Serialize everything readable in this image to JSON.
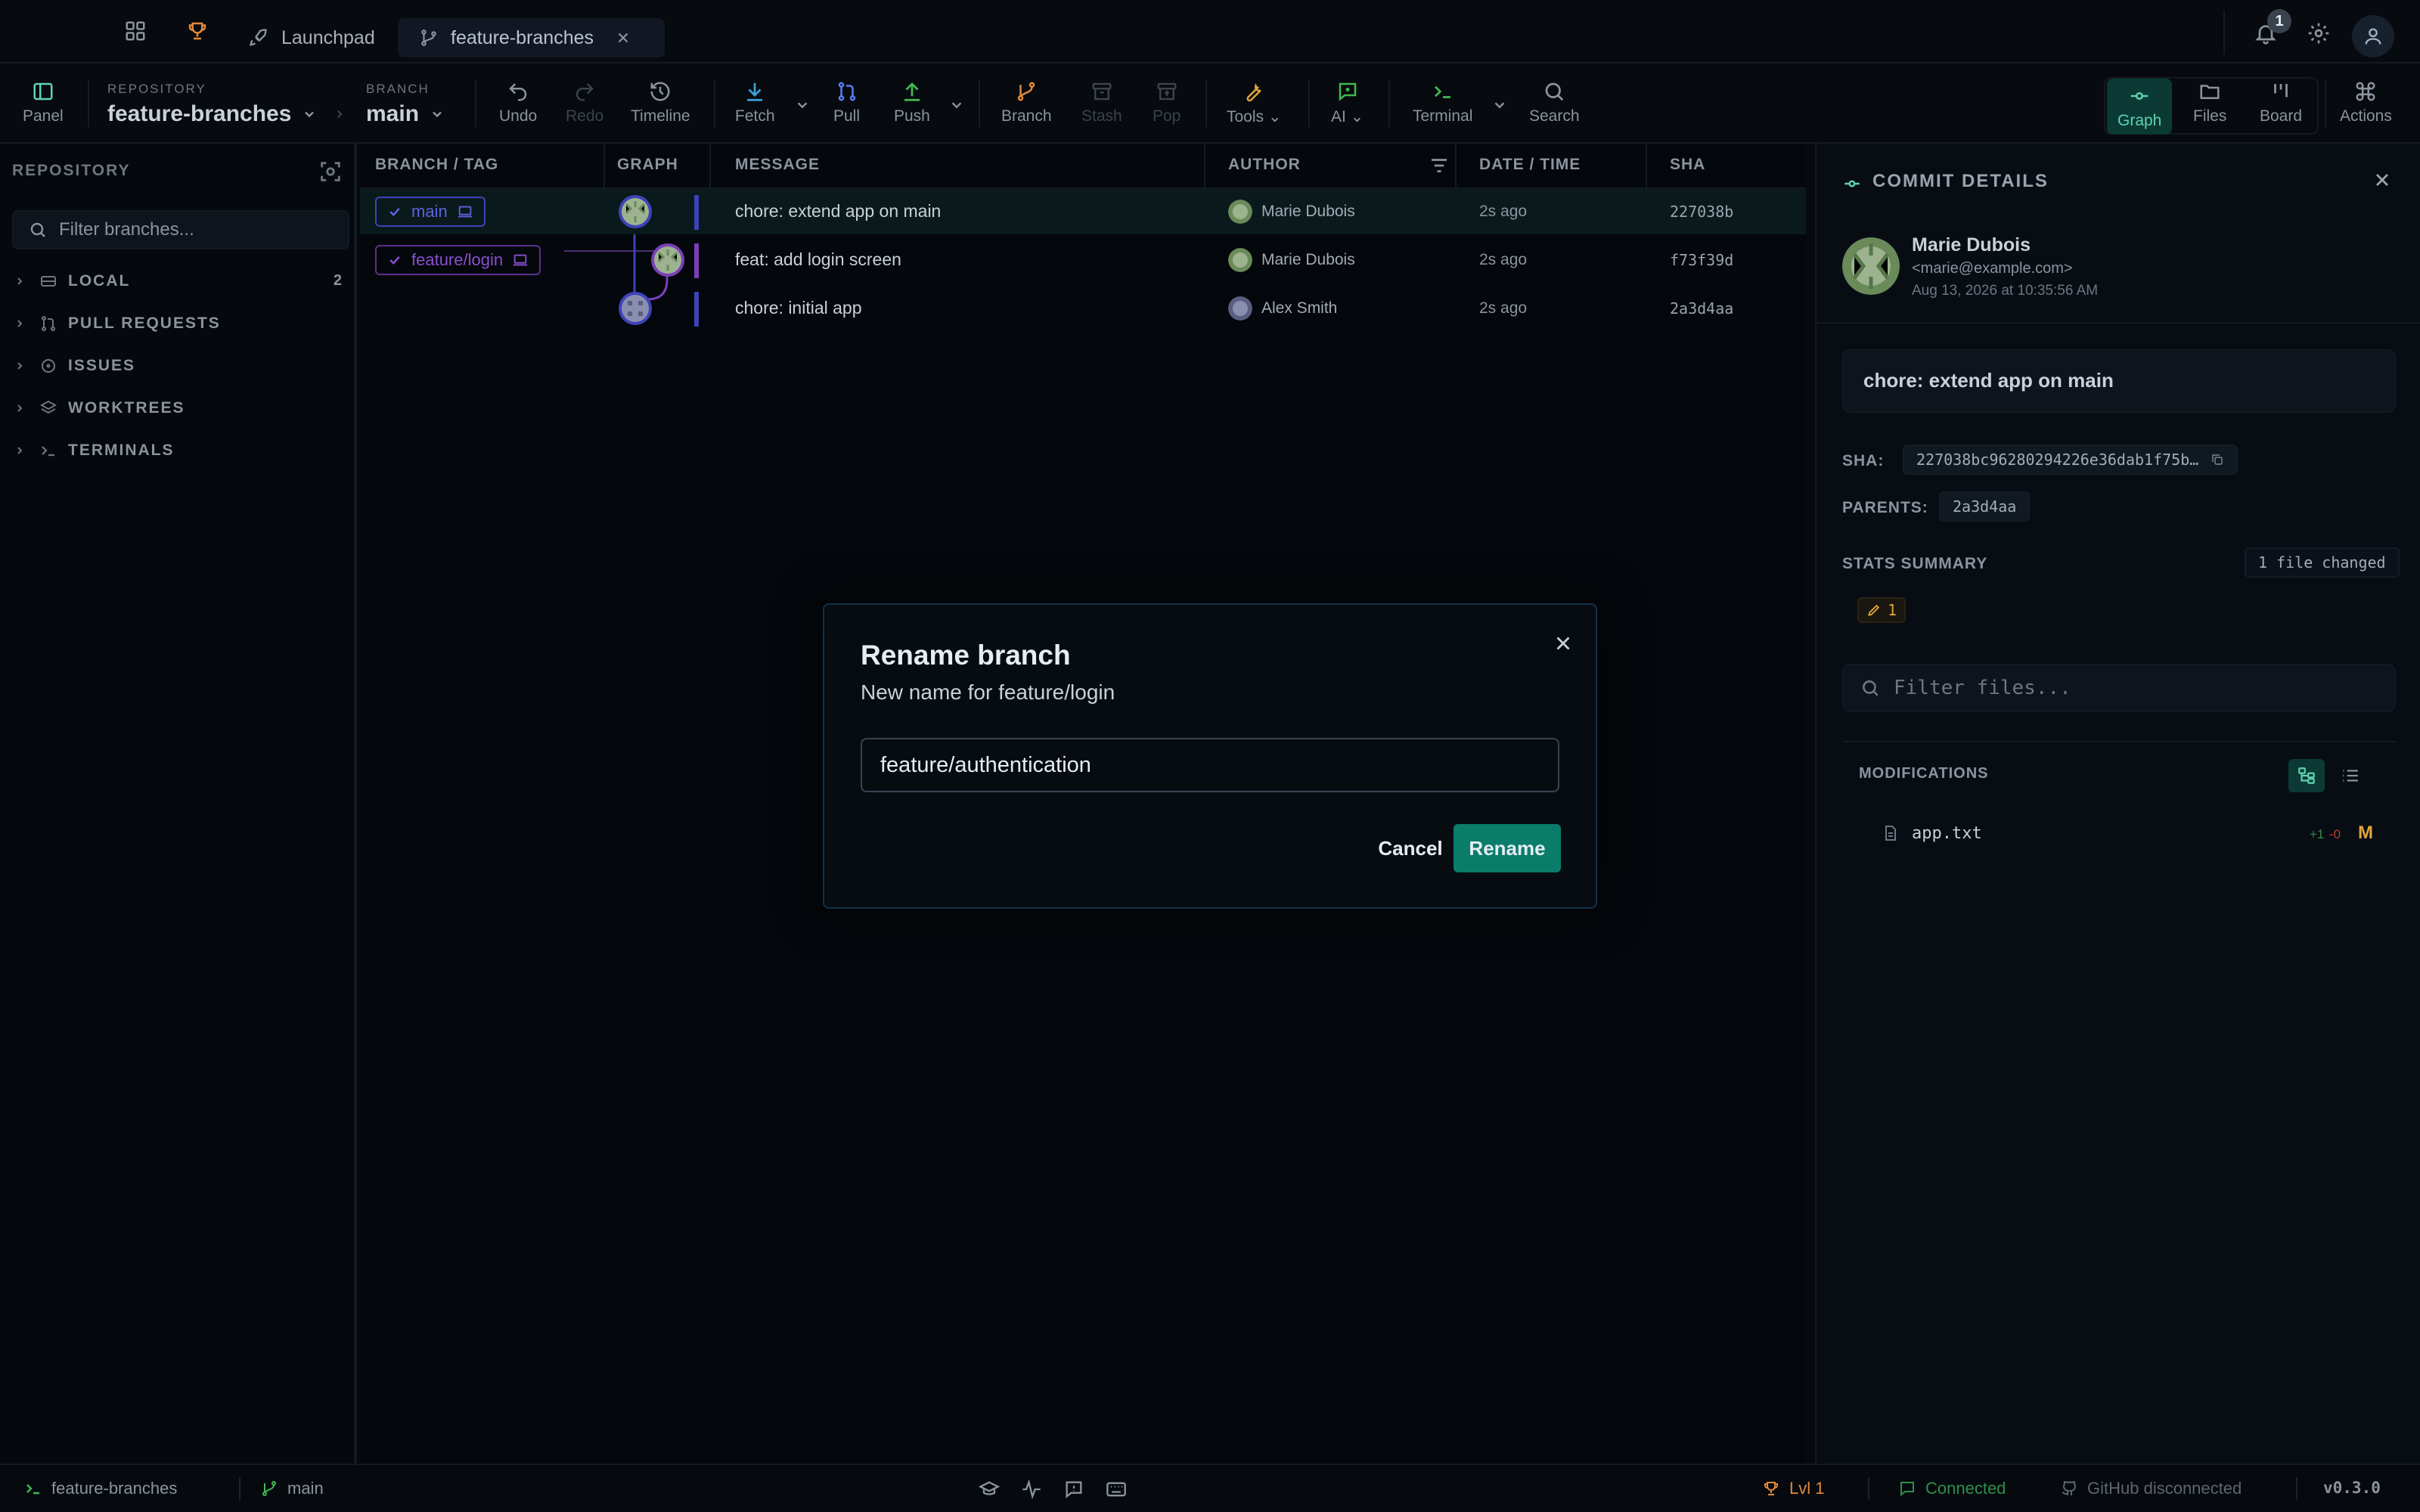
{
  "tabs": [
    {
      "label": "Launchpad"
    },
    {
      "label": "feature-branches"
    }
  ],
  "notifications": {
    "count": "1"
  },
  "toolbar": {
    "panel": "Panel",
    "repository_label": "REPOSITORY",
    "repository": "feature-branches",
    "branch_label": "BRANCH",
    "branch": "main",
    "undo": "Undo",
    "redo": "Redo",
    "timeline": "Timeline",
    "fetch": "Fetch",
    "pull": "Pull",
    "push": "Push",
    "branch_btn": "Branch",
    "stash": "Stash",
    "pop": "Pop",
    "tools": "Tools",
    "ai": "AI",
    "terminal": "Terminal",
    "search": "Search",
    "graph": "Graph",
    "files": "Files",
    "board": "Board",
    "actions": "Actions"
  },
  "sidebar": {
    "title": "REPOSITORY",
    "filter_placeholder": "Filter branches...",
    "sections": [
      {
        "label": "LOCAL",
        "count": "2"
      },
      {
        "label": "PULL REQUESTS"
      },
      {
        "label": "ISSUES"
      },
      {
        "label": "WORKTREES"
      },
      {
        "label": "TERMINALS"
      }
    ]
  },
  "graph": {
    "columns": [
      "BRANCH / TAG",
      "GRAPH",
      "MESSAGE",
      "AUTHOR",
      "DATE / TIME",
      "SHA"
    ],
    "rows": [
      {
        "branch": "main",
        "message": "chore: extend app on main",
        "author": "Marie Dubois",
        "date": "2s ago",
        "sha": "227038b"
      },
      {
        "branch": "feature/login",
        "message": "feat: add login screen",
        "author": "Marie Dubois",
        "date": "2s ago",
        "sha": "f73f39d"
      },
      {
        "branch": "",
        "message": "chore: initial app",
        "author": "Alex Smith",
        "date": "2s ago",
        "sha": "2a3d4aa"
      }
    ]
  },
  "details": {
    "title": "COMMIT DETAILS",
    "author_name": "Marie Dubois",
    "author_email": "<marie@example.com>",
    "date": "Aug 13, 2026 at 10:35:56 AM",
    "message": "chore: extend app on main",
    "sha_label": "SHA:",
    "sha": "227038bc96280294226e36dab1f75b…",
    "parents_label": "PARENTS:",
    "parent": "2a3d4aa",
    "stats_label": "STATS SUMMARY",
    "stats_value": "1 file changed",
    "modified_count": "1",
    "filter_placeholder": "Filter files...",
    "modifications_label": "MODIFICATIONS",
    "file": {
      "name": "app.txt",
      "added": "+1",
      "removed": "-0",
      "status": "M"
    }
  },
  "status": {
    "repo": "feature-branches",
    "branch": "main",
    "level": "Lvl 1",
    "connection": "Connected",
    "github": "GitHub disconnected",
    "version": "v0.3.0"
  },
  "dialog": {
    "title": "Rename branch",
    "subtitle": "New name for feature/login",
    "value": "feature/authentication",
    "cancel": "Cancel",
    "confirm": "Rename"
  },
  "colors": {
    "accent": "#0a7c6a",
    "main_lane": "#3d43b8",
    "feature_lane": "#7a3fb8",
    "connected": "#3fb950",
    "level": "#e3a33a"
  }
}
